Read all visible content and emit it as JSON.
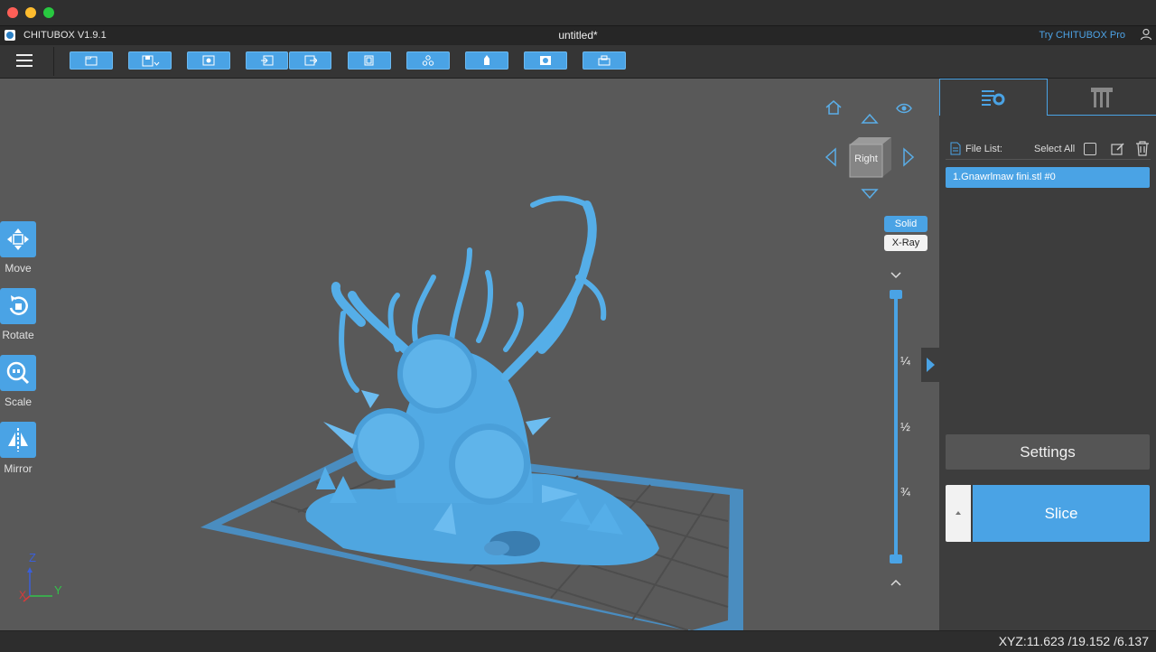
{
  "app": {
    "name": "CHITUBOX V1.9.1",
    "doc_title": "untitled*",
    "try_pro": "Try CHITUBOX Pro"
  },
  "left_tools": [
    {
      "label": "Move"
    },
    {
      "label": "Rotate"
    },
    {
      "label": "Scale"
    },
    {
      "label": "Mirror"
    }
  ],
  "view": {
    "cube_face": "Right",
    "solid_label": "Solid",
    "xray_label": "X-Ray",
    "slider_marks": [
      "¼",
      "½",
      "¾"
    ],
    "slider_level": 0
  },
  "axes": {
    "z": "Z",
    "x": "X",
    "y": "Y"
  },
  "file_panel": {
    "file_list_label": "File List:",
    "select_all_label": "Select All",
    "files": [
      "1.Gnawrlmaw fini.stl #0"
    ]
  },
  "settings_label": "Settings",
  "slice_label": "Slice",
  "status": {
    "xyz": "XYZ:11.623 /19.152 /6.137"
  },
  "colors": {
    "accent": "#4aa3e5",
    "model": "#5ab4ec",
    "viewport": "#595959",
    "panel": "#3d3d3d"
  }
}
